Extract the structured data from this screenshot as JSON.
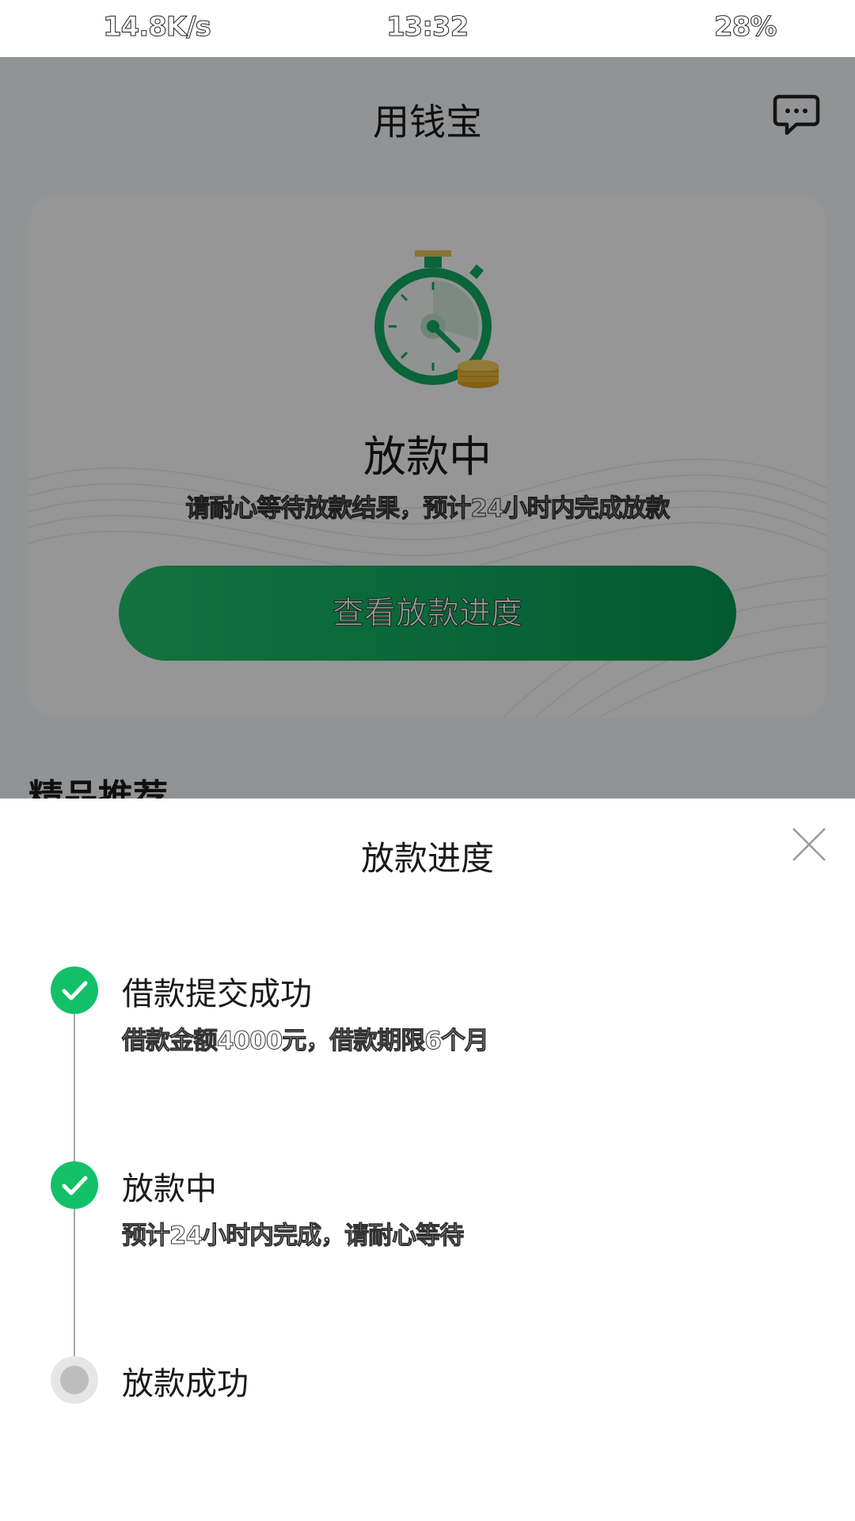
{
  "status_bar": {
    "speed": "14.8K/s",
    "time": "13:32",
    "battery": "28%"
  },
  "app": {
    "title": "用钱宝",
    "message_icon": "chat-bubble-icon",
    "card": {
      "icon": "stopwatch-coins-icon",
      "title": "放款中",
      "subtitle": "请耐心等待放款结果，预计24小时内完成放款",
      "button_label": "查看放款进度"
    },
    "section_title": "精品推荐"
  },
  "sheet": {
    "title": "放款进度",
    "close_icon": "close-icon",
    "steps": [
      {
        "title": "借款提交成功",
        "desc": "借款金额4000元，借款期限6个月",
        "state": "done"
      },
      {
        "title": "放款中",
        "desc": "预计24小时内完成，请耐心等待",
        "state": "done"
      },
      {
        "title": "放款成功",
        "desc": "",
        "state": "pending"
      }
    ]
  },
  "colors": {
    "accent": "#12c167",
    "button_start": "#1fbf6a",
    "button_end": "#06964f",
    "overlay": "rgba(0,0,0,0.4)"
  }
}
